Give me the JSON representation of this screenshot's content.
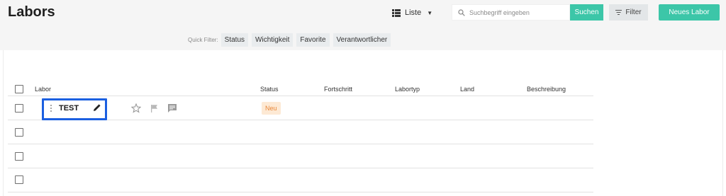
{
  "header": {
    "title": "Labors",
    "view_label": "Liste",
    "search_placeholder": "Suchbegriff eingeben",
    "search_button": "Suchen",
    "filter_button": "Filter",
    "new_button": "Neues Labor"
  },
  "quick_filter": {
    "label": "Quick Filter:",
    "chips": [
      "Status",
      "Wichtigkeit",
      "Favorite",
      "Verantwortlicher"
    ]
  },
  "table": {
    "columns": [
      "Labor",
      "Status",
      "Fortschritt",
      "Labortyp",
      "Land",
      "Beschreibung"
    ],
    "rows": [
      {
        "name": "TEST",
        "status": "Neu"
      }
    ]
  },
  "colors": {
    "accent": "#3cc6a8",
    "highlight": "#1b5fe0",
    "status_badge_bg": "#fde9d4",
    "status_badge_text": "#e8873a"
  },
  "icons": [
    "list-view-icon",
    "chevron-down-icon",
    "search-icon",
    "filter-icon",
    "drag-handle-icon",
    "pencil-icon",
    "star-icon",
    "flag-icon",
    "comment-icon"
  ]
}
